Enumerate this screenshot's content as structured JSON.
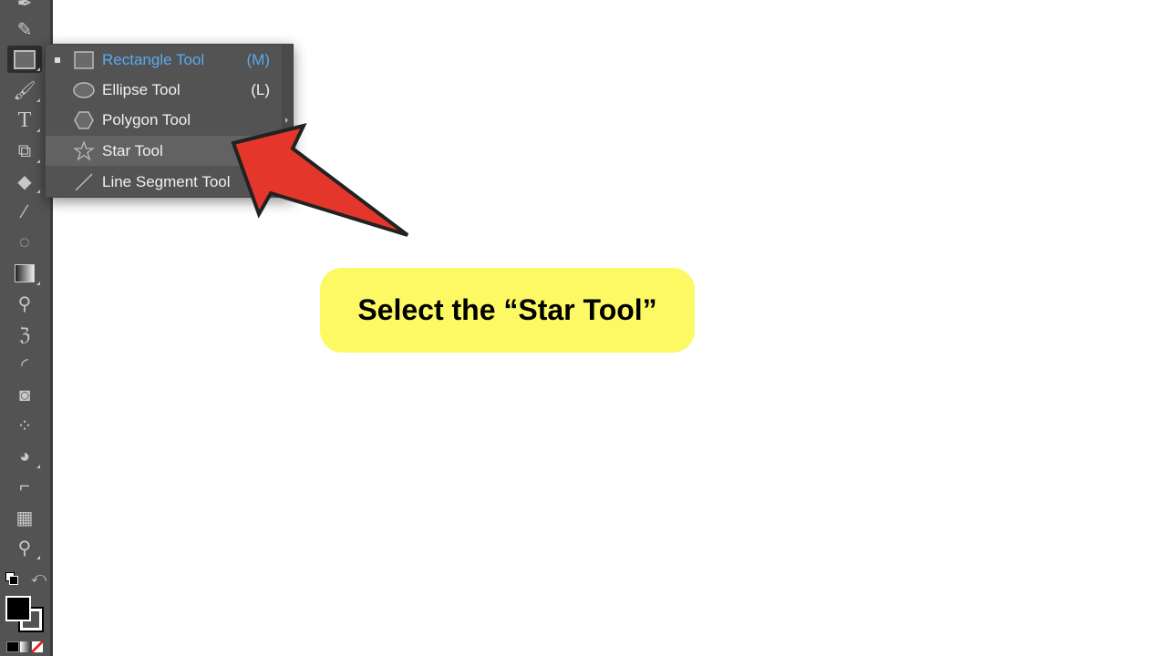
{
  "toolbar": {
    "tools": [
      "pen-tool",
      "curvature-tool",
      "rectangle-tool",
      "paintbrush-tool",
      "type-tool",
      "scale-tool",
      "eraser-tool",
      "eyedropper-pen-tool",
      "lasso-select-tool",
      "gradient-tool",
      "eyedropper-tool",
      "puppet-warp-tool",
      "arc-tool",
      "shape-builder-tool",
      "symbol-sprayer-tool",
      "pie-graph-tool",
      "artboard-tool",
      "perspective-grid-tool",
      "zoom-tool"
    ],
    "type_glyph": "T",
    "fill_color": "#000000",
    "stroke_color": "#000000"
  },
  "flyout": {
    "items": [
      {
        "label": "Rectangle Tool",
        "shortcut": "(M)",
        "icon": "rectangle-icon",
        "selected": true
      },
      {
        "label": "Ellipse Tool",
        "shortcut": "(L)",
        "icon": "ellipse-icon"
      },
      {
        "label": "Polygon Tool",
        "shortcut": "",
        "icon": "polygon-icon"
      },
      {
        "label": "Star Tool",
        "shortcut": "",
        "icon": "star-icon",
        "hovered": true
      },
      {
        "label": "Line Segment Tool",
        "shortcut": "",
        "icon": "line-icon"
      }
    ],
    "selected_color": "#5aa9f0"
  },
  "annotation": {
    "callout_text": "Select the “Star Tool”",
    "callout_color": "#fdf964",
    "arrow_color": "#e5362b"
  }
}
